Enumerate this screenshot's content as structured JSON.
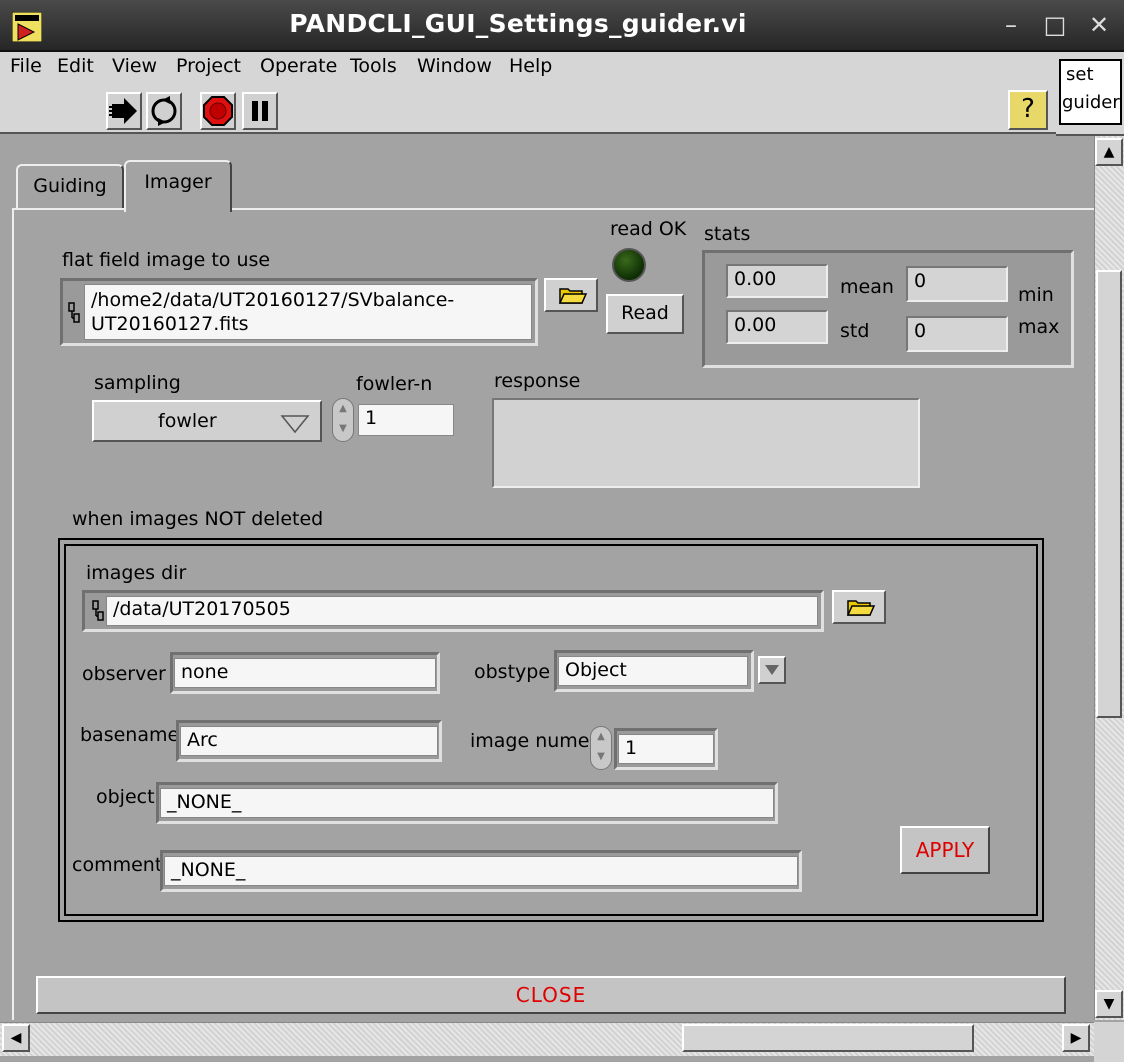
{
  "window": {
    "title": "PANDCLI_GUI_Settings_guider.vi",
    "min_glyph": "–",
    "max_glyph": "□",
    "close_glyph": "✕"
  },
  "menu": [
    "File",
    "Edit",
    "View",
    "Project",
    "Operate",
    "Tools",
    "Window",
    "Help"
  ],
  "toolbar_note": {
    "line1": "set",
    "line2": "guider"
  },
  "help_glyph": "?",
  "tabs": {
    "guiding": "Guiding",
    "imager": "Imager"
  },
  "flat": {
    "label": "flat field image to use",
    "path_line1": "/home2/data/UT20160127/SVbalance-",
    "path_line2": "UT20160127.fits",
    "read_label": "Read",
    "read_ok_label": "read OK"
  },
  "stats": {
    "label": "stats",
    "mean_value": "0.00",
    "mean_label": "mean",
    "std_value": "0.00",
    "std_label": "std",
    "min_value": "0",
    "min_label": "min",
    "max_value": "0",
    "max_label": "max"
  },
  "sampling": {
    "label": "sampling",
    "value": "fowler"
  },
  "fowler_n": {
    "label": "fowler-n",
    "value": "1"
  },
  "response": {
    "label": "response",
    "value": ""
  },
  "images": {
    "section_label": "when images NOT deleted",
    "dir_label": "images dir",
    "dir_value": "/data/UT20170505",
    "observer_label": "observer",
    "observer_value": "none",
    "obstype_label": "obstype",
    "obstype_value": "Object",
    "basename_label": "basename",
    "basename_value": "Arc",
    "image_numer_label": "image numer",
    "image_numer_value": "1",
    "object_label": "object",
    "object_value": "_NONE_",
    "comment_label": "comment",
    "comment_value": "_NONE_",
    "apply_label": "APPLY"
  },
  "close_label": "CLOSE",
  "colors": {
    "background": "#a3a3a3",
    "action_text": "#e00000",
    "led_off": "#1a4a0a"
  }
}
